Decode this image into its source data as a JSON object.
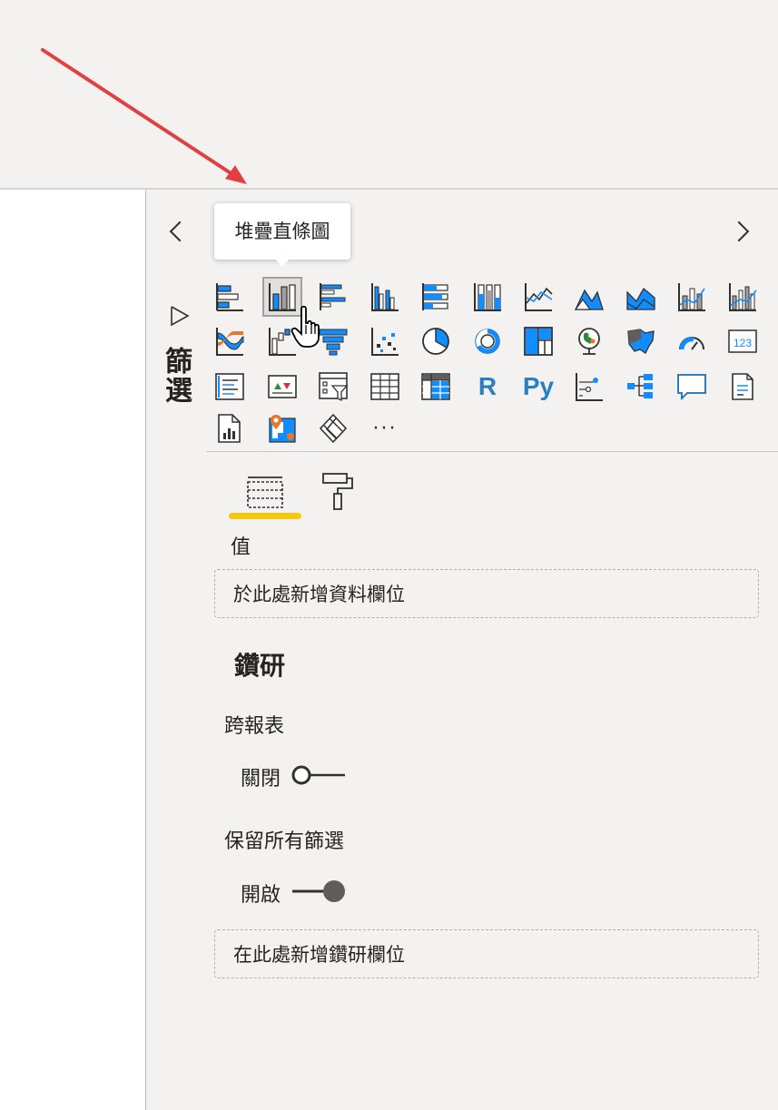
{
  "filter_pane": {
    "label": "篩選"
  },
  "viz_pane": {
    "tooltip": "堆疊直條圖",
    "tabs": [
      {
        "name": "fields-tab",
        "icon": "fields-grid-icon"
      },
      {
        "name": "format-tab",
        "icon": "paint-roller-icon"
      }
    ],
    "values_label": "值",
    "values_placeholder": "於此處新增資料欄位",
    "drill_title": "鑽研",
    "cross_report_label": "跨報表",
    "cross_report_state": "關閉",
    "keep_filters_label": "保留所有篩選",
    "keep_filters_state": "開啟",
    "drill_placeholder": "在此處新增鑽研欄位"
  },
  "colors": {
    "accent_blue": "#118dff",
    "tab_underline": "#f2c811",
    "arrow_red": "#e04040"
  },
  "visual_icons": [
    "stacked-bar-icon",
    "stacked-column-icon",
    "clustered-bar-icon",
    "clustered-column-icon",
    "100-stacked-bar-icon",
    "100-stacked-column-icon",
    "line-chart-icon",
    "area-chart-icon",
    "stacked-area-icon",
    "line-stacked-column-icon",
    "line-clustered-column-icon",
    "ribbon-chart-icon",
    "waterfall-icon",
    "funnel-icon",
    "scatter-icon",
    "pie-icon",
    "donut-icon",
    "treemap-icon",
    "map-icon",
    "filled-map-icon",
    "gauge-icon",
    "card-icon",
    "multi-row-card-icon",
    "kpi-icon",
    "slicer-icon",
    "table-icon",
    "matrix-icon",
    "r-visual-icon",
    "python-visual-icon",
    "key-influencers-icon",
    "decomposition-tree-icon",
    "qa-icon",
    "smart-narrative-icon",
    "paginated-report-icon",
    "azure-map-icon",
    "power-apps-icon",
    "more-visuals-icon"
  ],
  "glyphs": {
    "r_visual": "R",
    "python_visual": "Py",
    "more": "···",
    "card": "123"
  }
}
